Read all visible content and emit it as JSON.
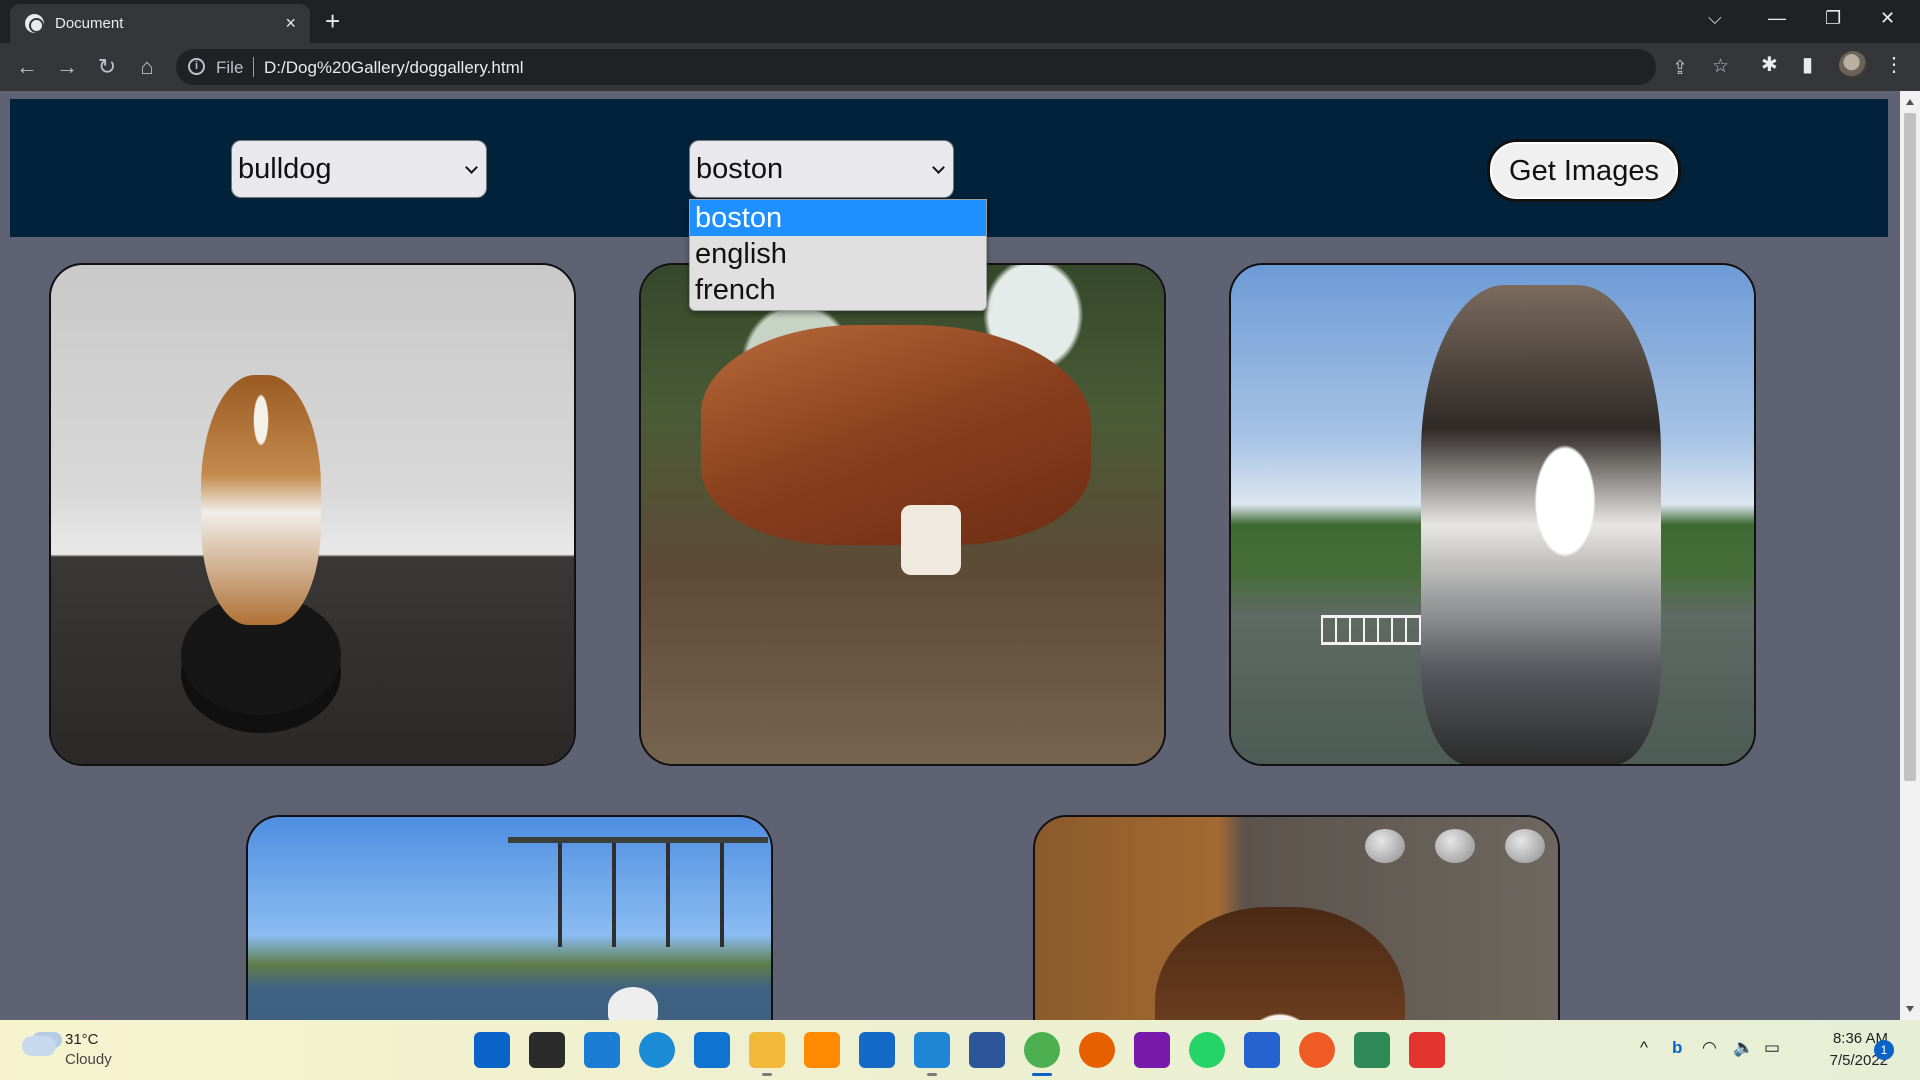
{
  "browser": {
    "tab_title": "Document",
    "tab_close": "×",
    "new_tab": "+",
    "window_controls": {
      "tab_search": "⌵",
      "minimize": "—",
      "restore": "❐",
      "close": "✕"
    },
    "nav": {
      "back": "←",
      "forward": "→",
      "reload": "↻",
      "home": "⌂"
    },
    "omnibox": {
      "scheme_label": "File",
      "url": "D:/Dog%20Gallery/doggallery.html",
      "info_icon": "i"
    },
    "omni_actions": {
      "share": "⇪",
      "bookmark": "☆"
    },
    "toolbar_right": {
      "extensions": "✱",
      "side_panel": "▮",
      "menu": "⋮"
    }
  },
  "page": {
    "breed_select": {
      "value": "bulldog"
    },
    "sub_breed_select": {
      "value": "boston",
      "options": [
        "boston",
        "english",
        "french"
      ],
      "highlighted": "boston"
    },
    "get_images_button": "Get Images",
    "images": [
      "dog photo 1",
      "dog photo 2",
      "dog photo 3",
      "dog photo 4",
      "dog photo 5"
    ]
  },
  "taskbar": {
    "weather": {
      "temp": "31°C",
      "condition": "Cloudy"
    },
    "apps": [
      {
        "name": "start-icon",
        "color": "#0a64c8"
      },
      {
        "name": "task-view-icon",
        "color": "#2b2b2b"
      },
      {
        "name": "desktop-icon",
        "color": "#1a7fd4"
      },
      {
        "name": "edge-icon",
        "color": "#1b8bd6"
      },
      {
        "name": "app-l-icon",
        "color": "#0f73d0"
      },
      {
        "name": "file-explorer-icon",
        "color": "#f2b83a"
      },
      {
        "name": "sublime-icon",
        "color": "#ff8a00"
      },
      {
        "name": "mail-icon",
        "color": "#1469c7"
      },
      {
        "name": "vscode-icon",
        "color": "#1f86d6"
      },
      {
        "name": "word-icon",
        "color": "#2b579a"
      },
      {
        "name": "chrome-icon",
        "color": "#4caf50"
      },
      {
        "name": "firefox-icon",
        "color": "#e66000"
      },
      {
        "name": "onenote-icon",
        "color": "#7719aa"
      },
      {
        "name": "whatsapp-icon",
        "color": "#25d366"
      },
      {
        "name": "todo-icon",
        "color": "#2564cf"
      },
      {
        "name": "postman-icon",
        "color": "#ef5b25"
      },
      {
        "name": "app-green-icon",
        "color": "#2e8b57"
      },
      {
        "name": "app-red-icon",
        "color": "#e3342f"
      }
    ],
    "tray": {
      "overflow": "^",
      "bing": "b",
      "wifi": "◠",
      "volume": "🔈",
      "battery": "▭"
    },
    "clock": {
      "time": "8:36 AM",
      "date": "7/5/2022"
    },
    "notification_count": "1"
  }
}
